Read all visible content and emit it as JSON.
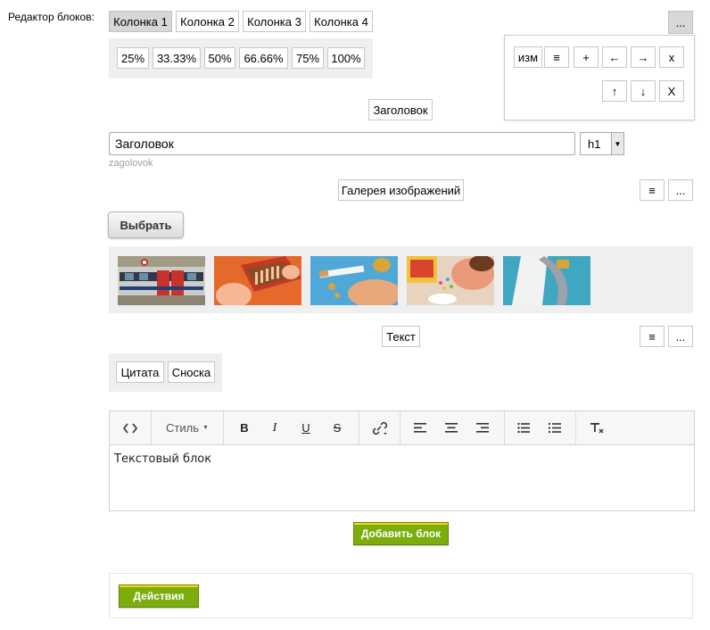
{
  "editor_label": "Редактор блоков:",
  "columns": [
    "Колонка 1",
    "Колонка 2",
    "Колонка 3",
    "Колонка 4"
  ],
  "widths": [
    "25%",
    "33.33%",
    "50%",
    "66.66%",
    "75%",
    "100%"
  ],
  "more_label": "...",
  "panel": {
    "row1": [
      "изм",
      "≡",
      "+",
      "←",
      "→",
      "x"
    ],
    "row2": [
      "↑",
      "↓",
      "X"
    ]
  },
  "heading_block": {
    "title": "Заголовок",
    "input_value": "Заголовок",
    "level": "h1",
    "hint": "zagolovok"
  },
  "gallery_block": {
    "title": "Галерея изображений",
    "menu_label": "≡",
    "more_label": "...",
    "select_label": "Выбрать"
  },
  "text_block": {
    "title": "Текст",
    "menu_label": "≡",
    "more_label": "...",
    "tags": [
      "Цитата",
      "Сноска"
    ],
    "style_label": "Стиль",
    "content": "Текстовый блок"
  },
  "add_block_label": "Добавить блок",
  "actions_label": "Действия",
  "colors": {
    "accent_green": "#7cad0d",
    "accent_yellow": "#ffd11a",
    "gray_panel": "#efefef"
  }
}
